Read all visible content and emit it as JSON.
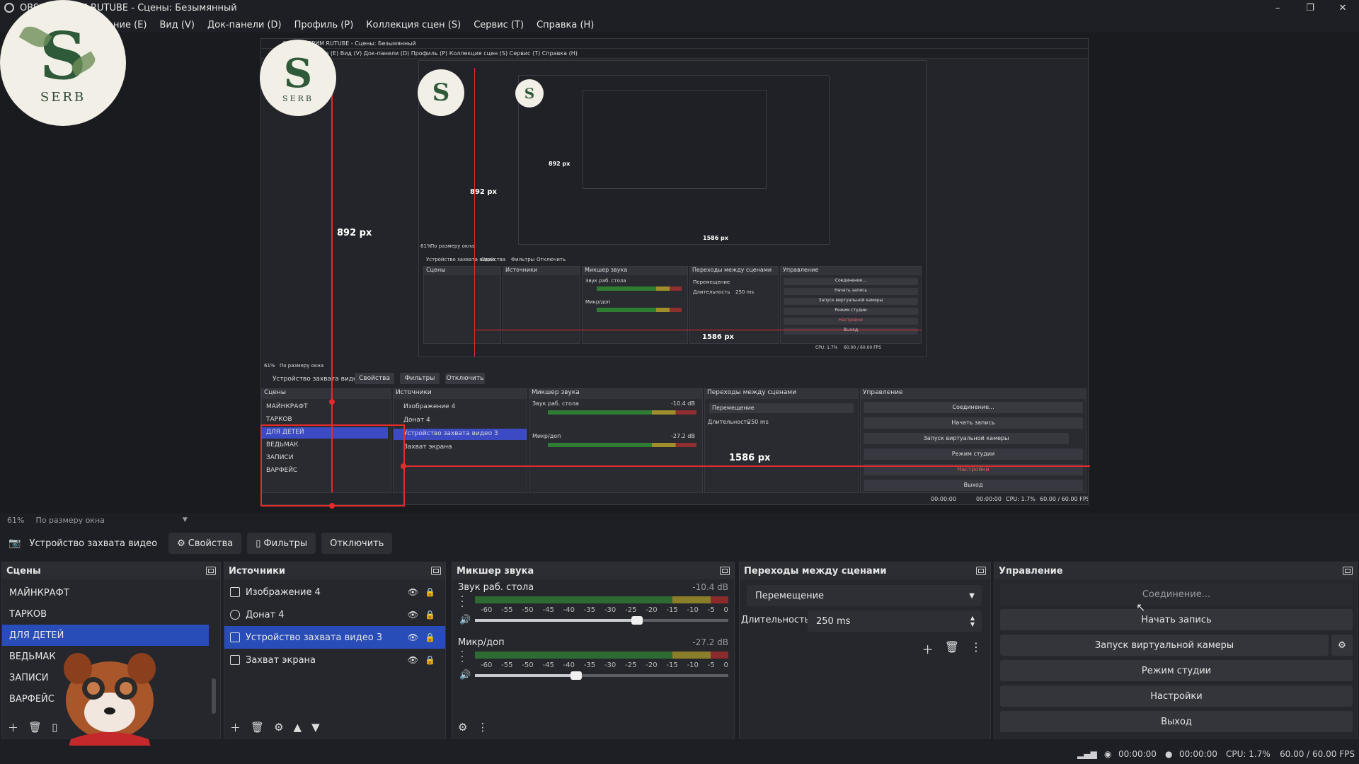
{
  "window": {
    "title": "OBS   ы: СТРИМ RUTUBE - Сцены: Безымянный",
    "minimize": "–",
    "maximize": "❐",
    "close": "✕"
  },
  "menu": [
    "ние (E)",
    "Вид (V)",
    "Док-панели (D)",
    "Профиль (P)",
    "Коллекция сцен (S)",
    "Сервис (T)",
    "Справка (H)"
  ],
  "logo": {
    "word": "SERB",
    "letter": "S"
  },
  "nested": {
    "title": "OBS   ы: СТРИМ RUTUBE - Сцены: Безымянный",
    "menu": "ние (E)   Вид (V)   Док-панели (D)   Профиль (P)   Коллекция сцен (S)   Сервис (T)   Справка (H)",
    "dim_height": "892 px",
    "dim_width": "1586 px",
    "zoom": "61%",
    "zoom_mode": "По размеру окна",
    "toolbar_source": "Устройство захвата видео",
    "toolbar_properties": "Свойства",
    "toolbar_filters": "Фильтры",
    "toolbar_disable": "Отключить",
    "docks": {
      "scenes": "Сцены",
      "sources": "Источники",
      "mixer": "Микшер звука",
      "transitions": "Переходы между сценами",
      "controls": "Управление"
    },
    "scenes": [
      "МАЙНКРАФТ",
      "ТАРКОВ",
      "ДЛЯ ДЕТЕЙ",
      "ВЕДЬМАК",
      "ЗАПИСИ",
      "ВАРФЕЙС"
    ],
    "sources": [
      "Изображение 4",
      "Донат 4",
      "Устройство захвата видео 3",
      "Захват экрана"
    ],
    "mixer_ch1": "Звук раб. стола",
    "mixer_ch1_db": "-10.4 dB",
    "mixer_ch2": "Микр/доп",
    "mixer_ch2_db": "-27.2 dB",
    "transition": "Перемещение",
    "duration_label": "Длительность",
    "duration": "250 ms",
    "controls": [
      "Соединение...",
      "Начать запись",
      "Запуск виртуальной камеры",
      "Режим студии",
      "Настройки",
      "Выход"
    ],
    "status_time1": "00:00:00",
    "status_time2": "00:00:00",
    "status_cpu": "CPU: 1.7%",
    "status_fps": "60.00 / 60.00 FPS"
  },
  "nested2": {
    "dim_height": "892 px",
    "dim_width": "1586 px",
    "zoom": "61%",
    "zoom_mode": "По размеру окна",
    "toolbar_source": "Устройство захвата видео",
    "toolbar_properties": "Свойства",
    "toolbar_filters": "Фильтры",
    "toolbar_disable": "Отключить",
    "docks": {
      "scenes": "Сцены",
      "sources": "Источники",
      "mixer": "Микшер звука",
      "transitions": "Переходы между сценами",
      "controls": "Управление"
    },
    "controls": [
      "Соединение...",
      "Начать запись",
      "Запуск виртуальной камеры",
      "Режим студии",
      "Настройки",
      "Выход"
    ],
    "scenes": [
      "МАЙНКРАФТ",
      "ТАРКОВ",
      "ДЛЯ ДЕТЕЙ",
      "ВЕДЬМАК",
      "ЗАПИСИ",
      "ВАРФЕЙС"
    ],
    "sources": [
      "Изображение 4",
      "Донат 4",
      "Устройство захвата видео 3",
      "Захват экрана"
    ],
    "mixer_ch1": "Звук раб. стола",
    "mixer_ch2": "Микр/доп",
    "transition": "Перемещение",
    "duration_label": "Длительность",
    "duration": "250 ms",
    "status_cpu": "CPU: 1.7%",
    "status_fps": "60.00 / 60.00 FPS"
  },
  "nested3": {
    "dim_height": "892 px",
    "dim_width": "1586 px"
  },
  "zoom_row": {
    "zoom": "61%",
    "mode": "По размеру окна"
  },
  "source_toolbar": {
    "source": "Устройство захвата видео",
    "properties": "Свойства",
    "filters": "Фильтры",
    "disable": "Отключить"
  },
  "scenes_dock": {
    "title": "Сцены",
    "items": [
      "МАЙНКРАФТ",
      "ТАРКОВ",
      "ДЛЯ ДЕТЕЙ",
      "ВЕДЬМАК",
      "ЗАПИСИ",
      "ВАРФЕЙС"
    ],
    "selected_index": 2
  },
  "sources_dock": {
    "title": "Источники",
    "items": [
      "Изображение 4",
      "Донат 4",
      "Устройство захвата видео 3",
      "Захват экрана"
    ],
    "selected_index": 2
  },
  "mixer_dock": {
    "title": "Микшер звука",
    "ticks": [
      "-60",
      "-55",
      "-50",
      "-45",
      "-40",
      "-35",
      "-30",
      "-25",
      "-20",
      "-15",
      "-10",
      "-5",
      "0"
    ],
    "channels": [
      {
        "name": "Звук раб. стола",
        "db": "-10.4 dB",
        "volume": 0.64
      },
      {
        "name": "Микр/доп",
        "db": "-27.2 dB",
        "volume": 0.4
      }
    ]
  },
  "transitions_dock": {
    "title": "Переходы между сценами",
    "transition": "Перемещение",
    "duration_label": "Длительность",
    "duration": "250 ms"
  },
  "controls_dock": {
    "title": "Управление",
    "connect": "Соединение...",
    "record": "Начать запись",
    "virtual_cam": "Запуск виртуальной камеры",
    "studio": "Режим студии",
    "settings": "Настройки",
    "exit": "Выход"
  },
  "status": {
    "time1": "00:00:00",
    "time2": "00:00:00",
    "cpu": "CPU: 1.7%",
    "fps": "60.00 / 60.00 FPS"
  },
  "colors": {
    "accent": "#284cb8",
    "guide": "#e52b2b",
    "bg": "#1e1f24"
  }
}
